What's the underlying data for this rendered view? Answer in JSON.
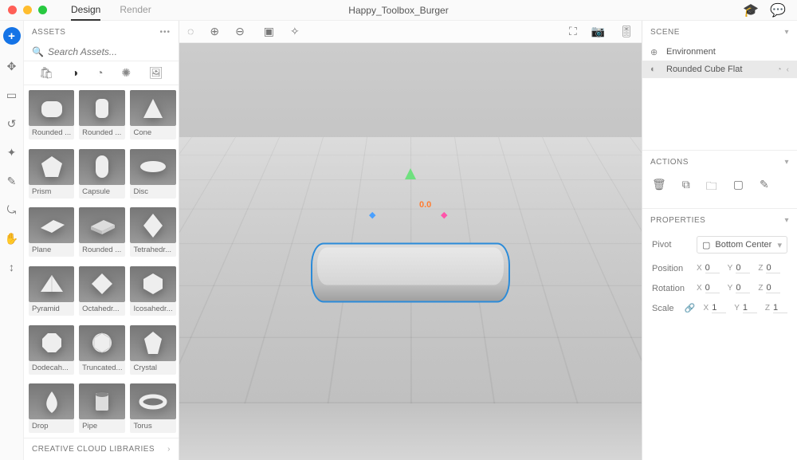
{
  "titlebar": {
    "tabs": [
      "Design",
      "Render"
    ],
    "active_tab": 0,
    "document_title": "Happy_Toolbox_Burger"
  },
  "assets_panel": {
    "heading": "ASSETS",
    "search_placeholder": "Search Assets...",
    "items": [
      {
        "label": "Rounded ..."
      },
      {
        "label": "Rounded ..."
      },
      {
        "label": "Cone"
      },
      {
        "label": "Prism"
      },
      {
        "label": "Capsule"
      },
      {
        "label": "Disc"
      },
      {
        "label": "Plane"
      },
      {
        "label": "Rounded ..."
      },
      {
        "label": "Tetrahedr..."
      },
      {
        "label": "Pyramid"
      },
      {
        "label": "Octahedr..."
      },
      {
        "label": "Icosahedr..."
      },
      {
        "label": "Dodecah..."
      },
      {
        "label": "Truncated..."
      },
      {
        "label": "Crystal"
      },
      {
        "label": "Drop"
      },
      {
        "label": "Pipe"
      },
      {
        "label": "Torus"
      }
    ],
    "cc_lib": "CREATIVE CLOUD LIBRARIES"
  },
  "scene_panel": {
    "heading": "SCENE",
    "rows": [
      {
        "label": "Environment",
        "selected": false
      },
      {
        "label": "Rounded Cube Flat",
        "selected": true
      }
    ]
  },
  "actions_panel": {
    "heading": "ACTIONS"
  },
  "properties_panel": {
    "heading": "PROPERTIES",
    "pivot_label": "Pivot",
    "pivot_value": "Bottom Center",
    "position_label": "Position",
    "rotation_label": "Rotation",
    "scale_label": "Scale",
    "position": {
      "x": "0",
      "y": "0",
      "z": "0"
    },
    "rotation": {
      "x": "0",
      "y": "0",
      "z": "0"
    },
    "scale": {
      "x": "1",
      "y": "1",
      "z": "1"
    },
    "axes": {
      "x": "X",
      "y": "Y",
      "z": "Z"
    }
  },
  "viewport": {
    "origin_label": "0.0"
  }
}
